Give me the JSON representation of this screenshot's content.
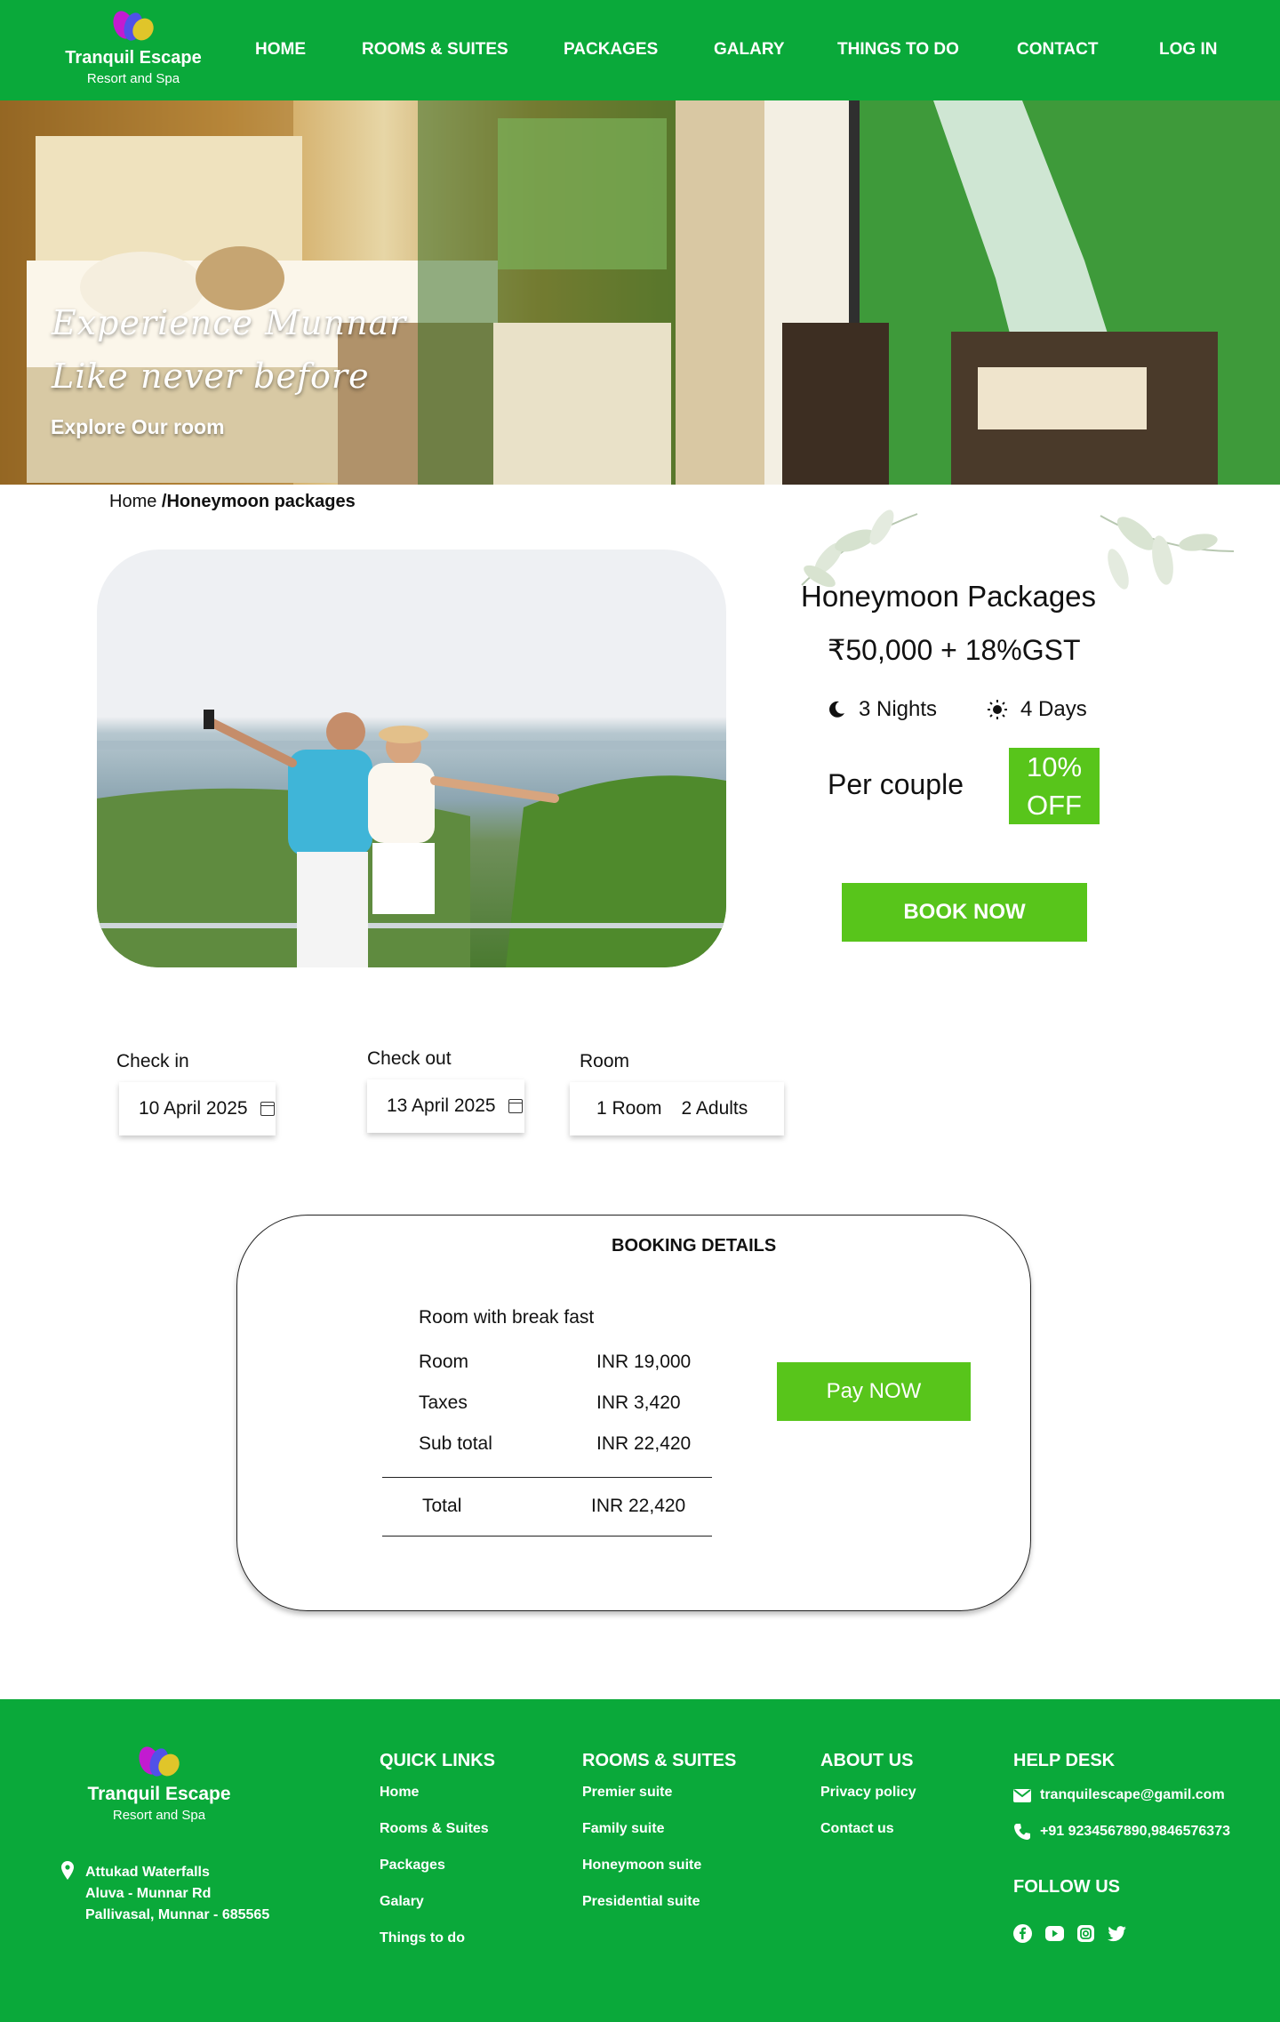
{
  "brand": {
    "name": "Tranquil Escape",
    "tagline": "Resort and Spa"
  },
  "nav": {
    "items": [
      {
        "label": "HOME"
      },
      {
        "label": "ROOMS & SUITES"
      },
      {
        "label": "PACKAGES"
      },
      {
        "label": "GALARY"
      },
      {
        "label": "THINGS TO DO"
      },
      {
        "label": "CONTACT"
      },
      {
        "label": "LOG IN"
      }
    ]
  },
  "hero": {
    "line1": "Experience Munnar",
    "line2": "Like never before",
    "cta": "Explore Our room"
  },
  "breadcrumb": {
    "home": "Home",
    "current": "/Honeymoon packages"
  },
  "package": {
    "title": "Honeymoon Packages",
    "price": "₹50,000 + 18%GST",
    "nights": "3 Nights",
    "days": "4 Days",
    "per": "Per couple",
    "discount_line1": "10%",
    "discount_line2": "OFF",
    "book_label": "BOOK NOW"
  },
  "search": {
    "checkin_label": "Check in",
    "checkin_value": "10 April 2025",
    "checkout_label": "Check out",
    "checkout_value": "13 April 2025",
    "room_label": "Room",
    "room_value": "1 Room",
    "guests_value": "2 Adults"
  },
  "booking": {
    "title": "BOOKING DETAILS",
    "subtitle": "Room with break fast",
    "rows": [
      {
        "label": "Room",
        "value": "INR 19,000"
      },
      {
        "label": "Taxes",
        "value": "INR 3,420"
      },
      {
        "label": "Sub total",
        "value": "INR 22,420"
      }
    ],
    "total_label": "Total",
    "total_value": "INR 22,420",
    "pay_label": "Pay NOW"
  },
  "footer": {
    "address": [
      "Attukad Waterfalls",
      "Aluva - Munnar Rd",
      "Pallivasal, Munnar - 685565"
    ],
    "quick_links": {
      "title": "QUICK LINKS",
      "items": [
        "Home",
        "Rooms & Suites",
        "Packages",
        "Galary",
        "Things to do"
      ]
    },
    "rooms": {
      "title": "ROOMS & SUITES",
      "items": [
        "Premier suite",
        "Family suite",
        "Honeymoon suite",
        "Presidential suite"
      ]
    },
    "about": {
      "title": "ABOUT US",
      "items": [
        "Privacy policy",
        "Contact us"
      ]
    },
    "help": {
      "title": "HELP DESK",
      "email": "tranquilescape@gamil.com",
      "phone": "+91 9234567890,9846576373"
    },
    "follow": {
      "title": "FOLLOW US",
      "icons": [
        "facebook-icon",
        "youtube-icon",
        "instagram-icon",
        "twitter-icon"
      ]
    }
  },
  "colors": {
    "primary": "#0aa93a",
    "accent": "#58c51b"
  }
}
